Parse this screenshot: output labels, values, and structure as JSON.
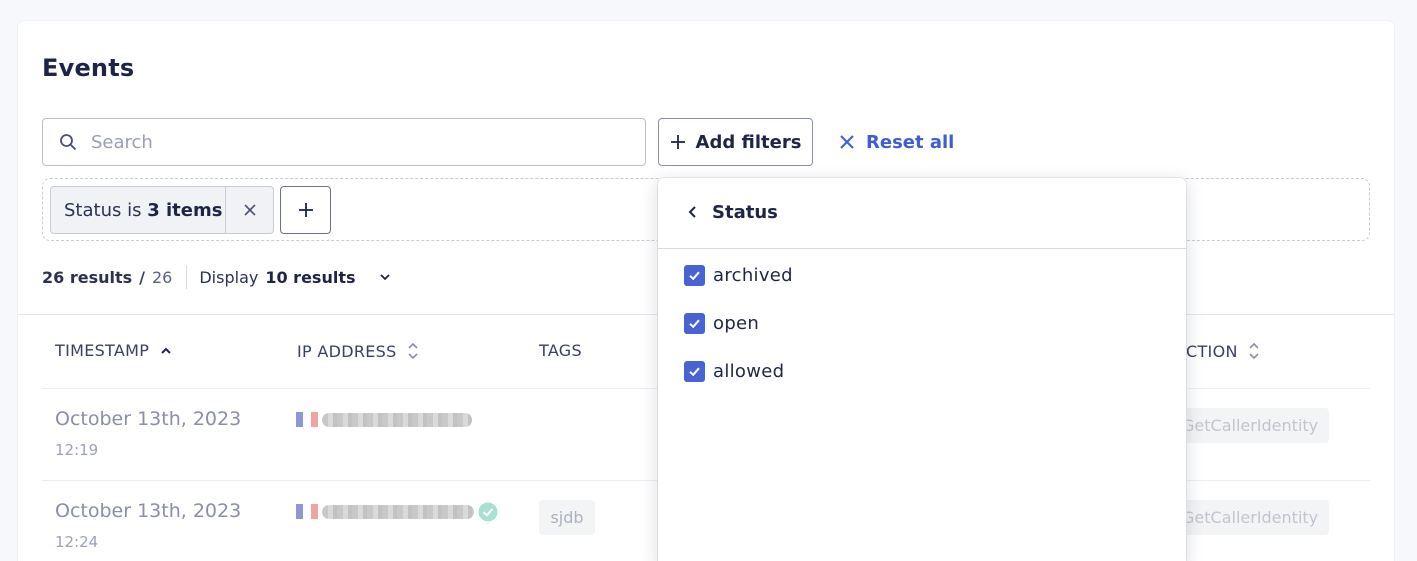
{
  "page": {
    "title": "Events"
  },
  "search": {
    "placeholder": "Search",
    "value": ""
  },
  "toolbar": {
    "add_filters_label": "Add filters",
    "reset_all_label": "Reset all"
  },
  "active_filter": {
    "field": "Status is",
    "count_text": "3 items"
  },
  "results": {
    "count": "26 results",
    "separator": "/",
    "total": "26",
    "display_label": "Display",
    "display_value": "10 results"
  },
  "table": {
    "headers": {
      "timestamp": "TIMESTAMP",
      "ip_address": "IP ADDRESS",
      "tags": "TAGS",
      "action": "CTION"
    },
    "rows": [
      {
        "date": "October 13th, 2023",
        "time": "12:19",
        "tag": "",
        "action": "GetCallerIdentity"
      },
      {
        "date": "October 13th, 2023",
        "time": "12:24",
        "tag": "sjdb",
        "action": "GetCallerIdentity"
      }
    ]
  },
  "status_dropdown": {
    "title": "Status",
    "options": [
      {
        "label": "archived",
        "checked": true
      },
      {
        "label": "open",
        "checked": true
      },
      {
        "label": "allowed",
        "checked": true
      }
    ]
  },
  "colors": {
    "accent": "#3d5fd1",
    "checkbox": "#4763d4",
    "text": "#1f2547",
    "muted": "#8a8fa6",
    "verified": "#a8e0d1"
  },
  "icons": [
    "search-icon",
    "plus-icon",
    "close-icon",
    "chevron-down-icon",
    "sort-ascending-icon",
    "sort-icon",
    "chevron-left-icon",
    "checkbox-checked-icon",
    "flag-france-icon",
    "verified-icon"
  ]
}
